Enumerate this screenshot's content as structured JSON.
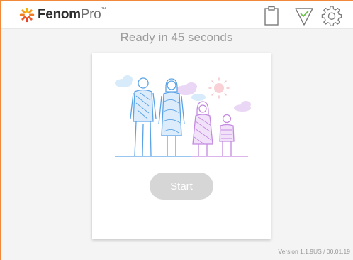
{
  "header": {
    "logo_brand": "Fenom",
    "logo_suffix": "Pro",
    "logo_tm": "™",
    "icons": [
      "clipboard-icon",
      "checkmark-icon",
      "gear-icon"
    ]
  },
  "status": {
    "ready_text": "Ready in 45 seconds"
  },
  "card": {
    "illustration": "family-illustration",
    "start_label": "Start"
  },
  "footer": {
    "version_text": "Version 1.1.9US / 00.01.19"
  },
  "colors": {
    "accent_orange": "#f08a3a",
    "blue_figures": "#5aa3e6",
    "purple_figures": "#c48ae0",
    "check_green": "#6cc04a",
    "button_disabled": "#d6d6d6"
  }
}
